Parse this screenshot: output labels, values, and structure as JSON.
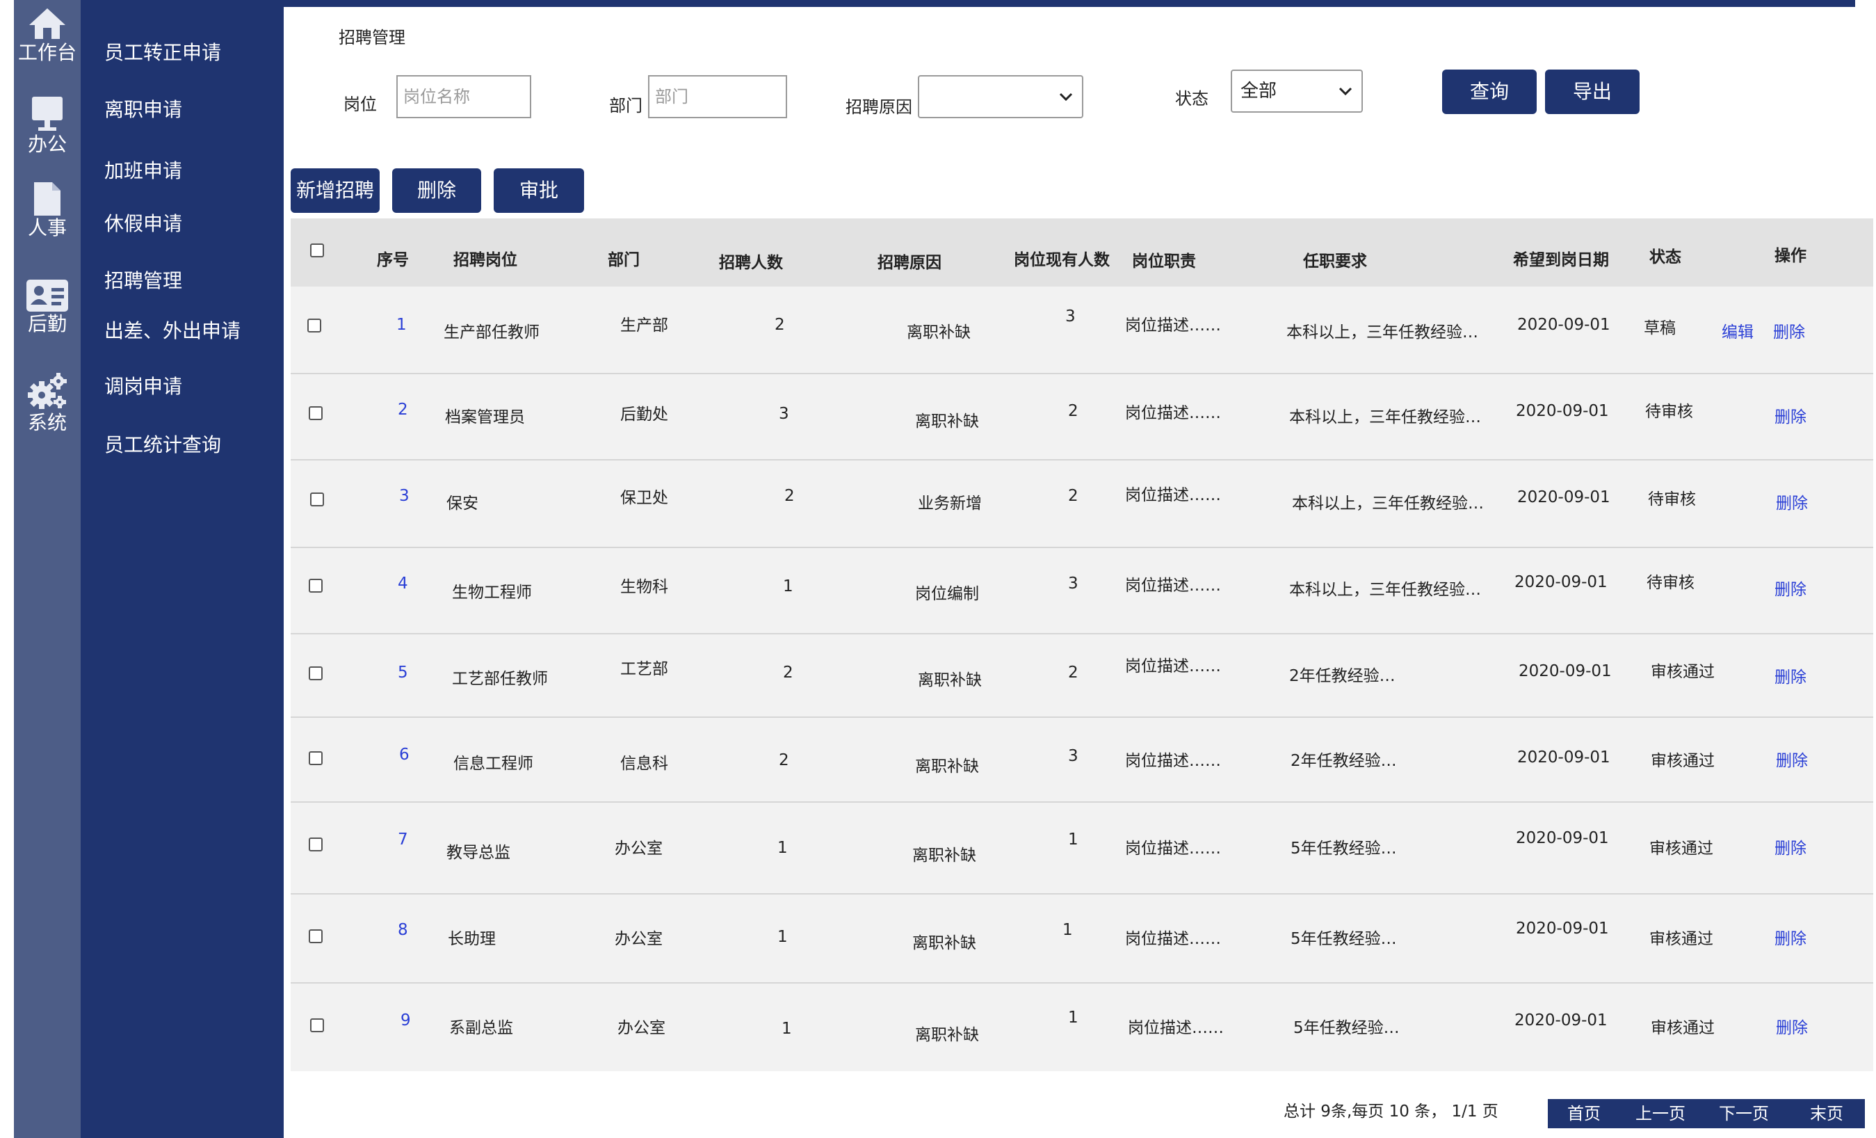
{
  "rail": [
    {
      "label": "工作台",
      "icon": "home-icon"
    },
    {
      "label": "办公",
      "icon": "monitor-icon"
    },
    {
      "label": "人事",
      "icon": "document-icon"
    },
    {
      "label": "后勤",
      "icon": "id-card-icon"
    },
    {
      "label": "系统",
      "icon": "gears-icon"
    }
  ],
  "menu": [
    "员工转正申请",
    "离职申请",
    "加班申请",
    "休假申请",
    "招聘管理",
    "出差、外出申请",
    "调岗申请",
    "员工统计查询"
  ],
  "page_title": "招聘管理",
  "filters": {
    "position_label": "岗位",
    "position_placeholder": "岗位名称",
    "dept_label": "部门",
    "dept_placeholder": "部门",
    "reason_label": "招聘原因",
    "reason_value": "",
    "status_label": "状态",
    "status_value": "全部",
    "query_button": "查询",
    "export_button": "导出"
  },
  "actions": {
    "add_button": "新增招聘",
    "delete_button": "删除",
    "approve_button": "审批"
  },
  "table": {
    "headers": [
      "序号",
      "招聘岗位",
      "部门",
      "招聘人数",
      "招聘原因",
      "岗位现有人数",
      "岗位职责",
      "任职要求",
      "希望到岗日期",
      "状态",
      "操作"
    ],
    "rows": [
      {
        "idx": "1",
        "post": "生产部任教师",
        "dept": "生产部",
        "count": "2",
        "reason": "离职补缺",
        "current": "3",
        "duty": "岗位描述……",
        "req": "本科以上，三年任教经验…",
        "date": "2020-09-01",
        "status": "草稿",
        "edit": "编辑",
        "del": "删除"
      },
      {
        "idx": "2",
        "post": "档案管理员",
        "dept": "后勤处",
        "count": "3",
        "reason": "离职补缺",
        "current": "2",
        "duty": "岗位描述……",
        "req": "本科以上，三年任教经验…",
        "date": "2020-09-01",
        "status": "待审核",
        "del": "删除"
      },
      {
        "idx": "3",
        "post": "保安",
        "dept": "保卫处",
        "count": "2",
        "reason": "业务新增",
        "current": "2",
        "duty": "岗位描述……",
        "req": "本科以上，三年任教经验…",
        "date": "2020-09-01",
        "status": "待审核",
        "del": "删除"
      },
      {
        "idx": "4",
        "post": "生物工程师",
        "dept": "生物科",
        "count": "1",
        "reason": "岗位编制",
        "current": "3",
        "duty": "岗位描述……",
        "req": "本科以上，三年任教经验…",
        "date": "2020-09-01",
        "status": "待审核",
        "del": "删除"
      },
      {
        "idx": "5",
        "post": "工艺部任教师",
        "dept": "工艺部",
        "count": "2",
        "reason": "离职补缺",
        "current": "2",
        "duty": "岗位描述……",
        "req": "2年任教经验…",
        "date": "2020-09-01",
        "status": "审核通过",
        "del": "删除"
      },
      {
        "idx": "6",
        "post": "信息工程师",
        "dept": "信息科",
        "count": "2",
        "reason": "离职补缺",
        "current": "3",
        "duty": "岗位描述……",
        "req": "2年任教经验…",
        "date": "2020-09-01",
        "status": "审核通过",
        "del": "删除"
      },
      {
        "idx": "7",
        "post": "教导总监",
        "dept": "办公室",
        "count": "1",
        "reason": "离职补缺",
        "current": "1",
        "duty": "岗位描述……",
        "req": "5年任教经验…",
        "date": "2020-09-01",
        "status": "审核通过",
        "del": "删除"
      },
      {
        "idx": "8",
        "post": "长助理",
        "dept": "办公室",
        "count": "1",
        "reason": "离职补缺",
        "current": "1",
        "duty": "岗位描述……",
        "req": "5年任教经验…",
        "date": "2020-09-01",
        "status": "审核通过",
        "del": "删除"
      },
      {
        "idx": "9",
        "post": "系副总监",
        "dept": "办公室",
        "count": "1",
        "reason": "离职补缺",
        "current": "1",
        "duty": "岗位描述……",
        "req": "5年任教经验…",
        "date": "2020-09-01",
        "status": "审核通过",
        "del": "删除"
      }
    ]
  },
  "pagination": {
    "summary": "总计 9条,每页  10 条，  1/1 页",
    "first": "首页",
    "prev": "上一页",
    "next": "下一页",
    "last": "末页"
  },
  "colors": {
    "nav": "#1f3470",
    "rail": "#4d5d87",
    "link": "#2a3fd6"
  }
}
